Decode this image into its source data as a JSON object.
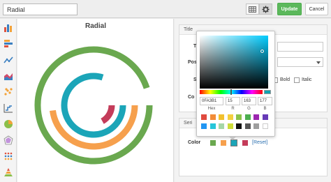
{
  "toolbar": {
    "chart_name": "Radial",
    "table_icon": "table-icon",
    "gear_icon": "gear-icon",
    "update_label": "Update",
    "cancel_label": "Cancel"
  },
  "sidebar": {
    "items": [
      {
        "icon": "bar-chart-icon"
      },
      {
        "icon": "horizontal-bar-icon"
      },
      {
        "icon": "line-chart-icon"
      },
      {
        "icon": "area-chart-icon"
      },
      {
        "icon": "scatter-icon"
      },
      {
        "icon": "step-line-icon"
      },
      {
        "icon": "pie-chart-icon"
      },
      {
        "icon": "spider-icon"
      },
      {
        "icon": "dot-matrix-icon"
      },
      {
        "icon": "pyramid-icon"
      }
    ]
  },
  "preview": {
    "title": "Radial"
  },
  "chart_data": {
    "type": "radial-bar",
    "title": "Radial",
    "series": [
      {
        "color": "#6aa84f",
        "fraction": 0.95
      },
      {
        "color": "#f6a04d",
        "fraction": 0.48
      },
      {
        "color": "#1ba5b8",
        "fraction": 0.8
      },
      {
        "color": "#c43c5a",
        "fraction": 0.17
      }
    ]
  },
  "settings": {
    "title_panel": {
      "heading": "Title",
      "text_label": "T",
      "position_label": "Pos",
      "style_label": "S",
      "bold_label": "Bold",
      "italic_label": "Italic",
      "color_label": "Co"
    },
    "series_panel": {
      "heading": "Seri",
      "color_label": "Color",
      "reset_label": "[Reset]",
      "colors": [
        "#6aa84f",
        "#f6a04d",
        "#1ba5b8",
        "#c43c5a"
      ]
    }
  },
  "color_picker": {
    "hex": "0FA3B1",
    "r": "15",
    "g": "163",
    "b": "177",
    "hex_label": "Hex",
    "r_label": "R",
    "g_label": "G",
    "b_label": "B",
    "current_color": "#0fa3b1",
    "palette": [
      "#e04a3f",
      "#f28c38",
      "#f2c12e",
      "#f4d03f",
      "#8bc34a",
      "#4caf50",
      "#9c27b0",
      "#673ab7",
      "#2196f3",
      "#26c6da",
      "#a5d6a7",
      "#cddc39",
      "#111111",
      "#555555",
      "#9e9e9e",
      "#ffffff"
    ]
  }
}
